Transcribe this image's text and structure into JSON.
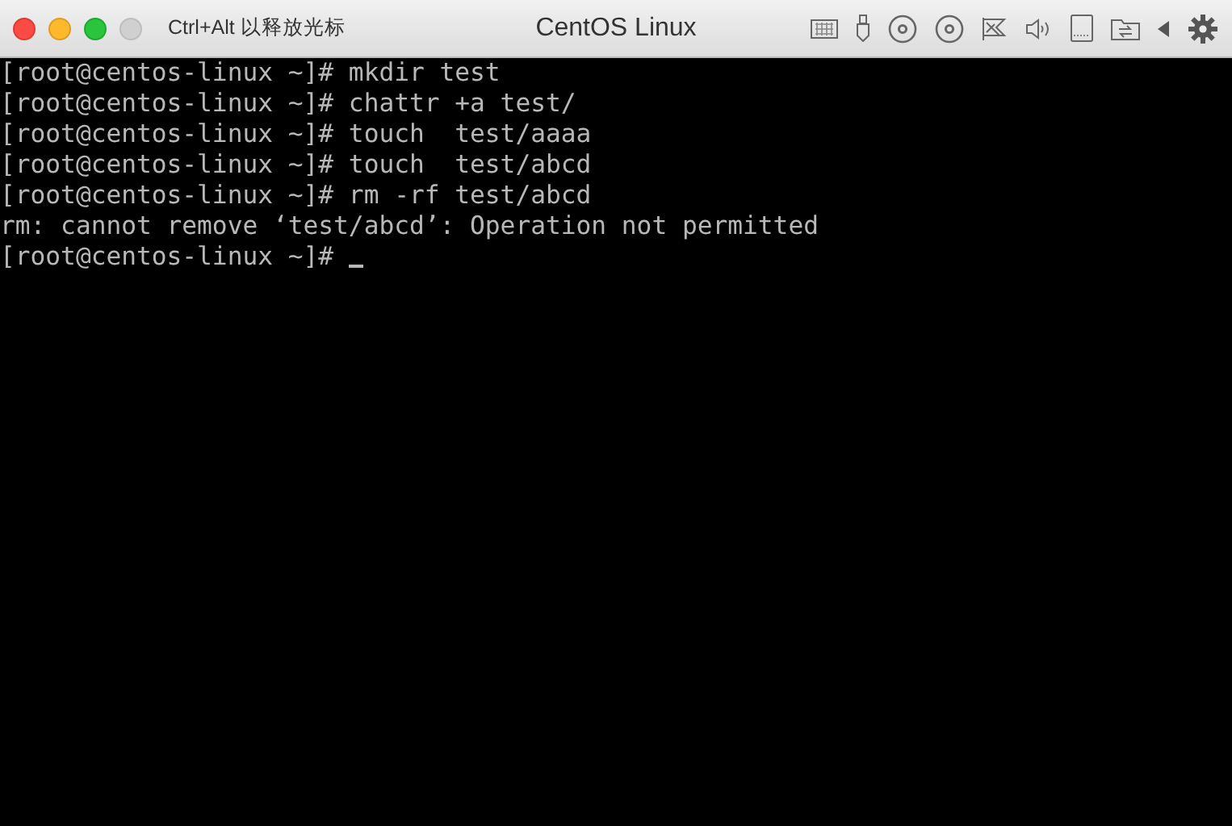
{
  "window": {
    "title": "CentOS Linux",
    "hint": "Ctrl+Alt 以释放光标"
  },
  "terminal": {
    "lines": [
      "[root@centos-linux ~]# mkdir test",
      "[root@centos-linux ~]# chattr +a test/",
      "[root@centos-linux ~]# touch  test/aaaa",
      "[root@centos-linux ~]# touch  test/abcd",
      "[root@centos-linux ~]# rm -rf test/abcd",
      "rm: cannot remove ‘test/abcd’: Operation not permitted"
    ],
    "prompt": "[root@centos-linux ~]#"
  }
}
